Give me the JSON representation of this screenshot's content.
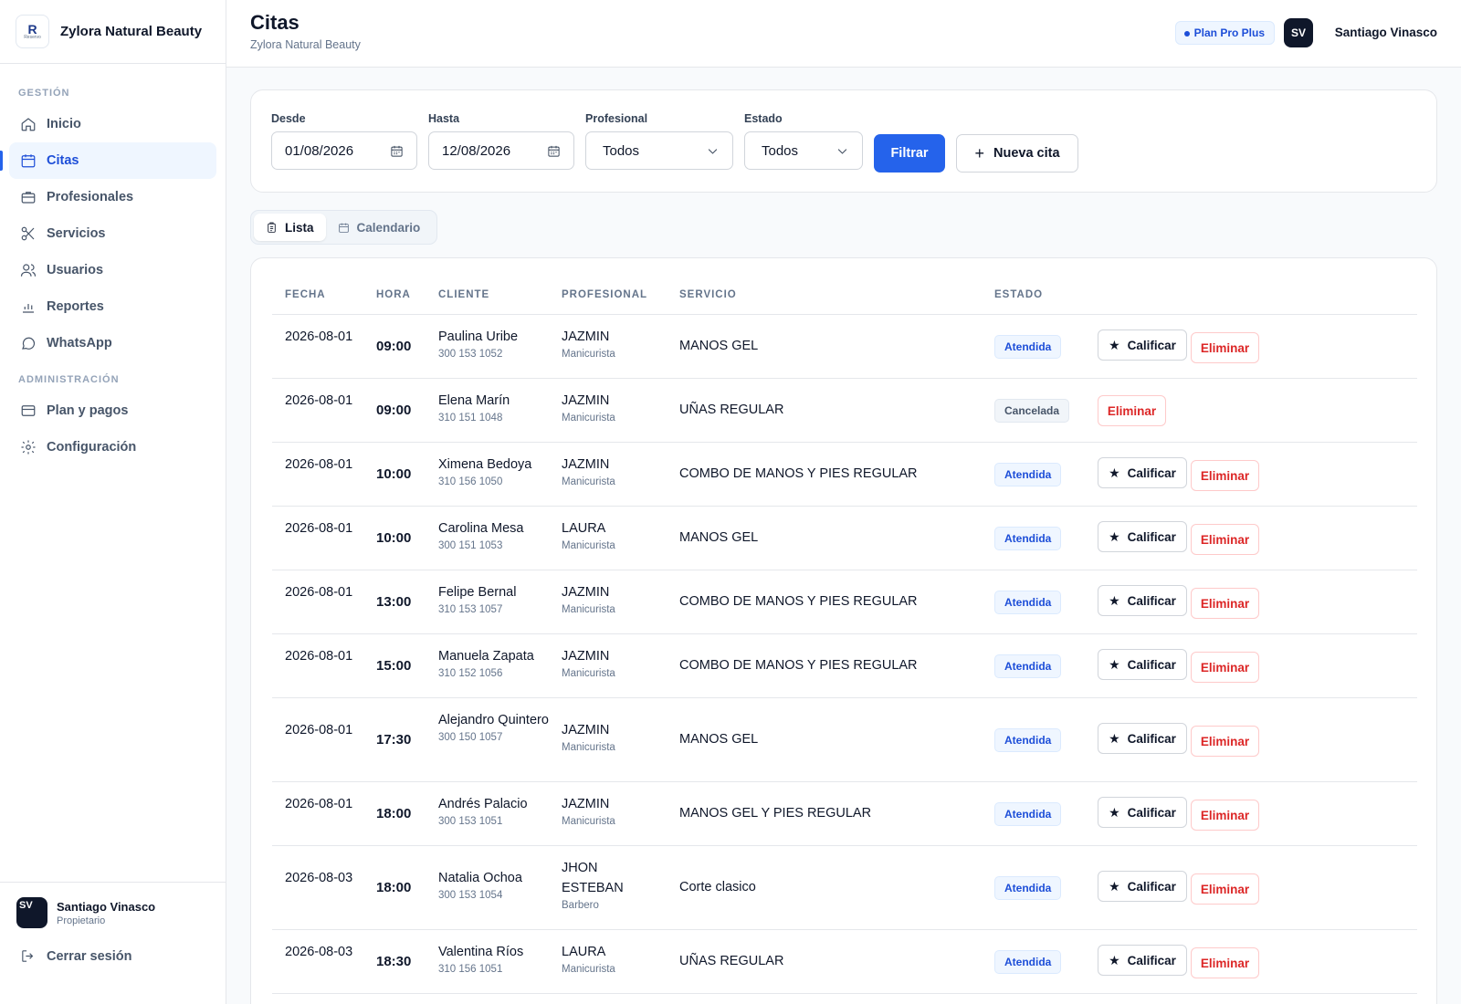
{
  "brand": {
    "name": "Zylora Natural Beauty",
    "logo_letter": "R",
    "logo_sub": "Reservo"
  },
  "sidebar": {
    "section_gestion": "GESTIÓN",
    "section_admin": "ADMINISTRACIÓN",
    "items": [
      {
        "label": "Inicio",
        "icon": "home-icon"
      },
      {
        "label": "Citas",
        "icon": "calendar-icon",
        "active": true
      },
      {
        "label": "Profesionales",
        "icon": "briefcase-icon"
      },
      {
        "label": "Servicios",
        "icon": "scissors-icon"
      },
      {
        "label": "Usuarios",
        "icon": "users-icon"
      },
      {
        "label": "Reportes",
        "icon": "bar-chart-icon"
      },
      {
        "label": "WhatsApp",
        "icon": "chat-bubble-icon"
      }
    ],
    "admin_items": [
      {
        "label": "Plan y pagos",
        "icon": "credit-card-icon"
      },
      {
        "label": "Configuración",
        "icon": "gear-icon"
      }
    ],
    "user": {
      "initials": "SV",
      "name": "Santiago Vinasco",
      "role": "Propietario"
    },
    "logout": "Cerrar sesión"
  },
  "header": {
    "title": "Citas",
    "subtitle": "Zylora Natural Beauty",
    "plan": "Plan Pro Plus",
    "user_initials": "SV",
    "user_name": "Santiago Vinasco"
  },
  "filters": {
    "desde_label": "Desde",
    "desde_value": "01/08/2026",
    "hasta_label": "Hasta",
    "hasta_value": "12/08/2026",
    "profesional_label": "Profesional",
    "profesional_value": "Todos",
    "estado_label": "Estado",
    "estado_value": "Todos",
    "filter_button": "Filtrar",
    "new_button": "Nueva cita"
  },
  "view_toggle": {
    "list": "Lista",
    "calendar": "Calendario"
  },
  "table": {
    "headers": {
      "fecha": "FECHA",
      "hora": "HORA",
      "cliente": "CLIENTE",
      "profesional": "PROFESIONAL",
      "servicio": "SERVICIO",
      "estado": "ESTADO"
    },
    "rate_label": "Calificar",
    "delete_label": "Eliminar",
    "rows": [
      {
        "fecha": "2026-08-01",
        "hora": "09:00",
        "cliente": "Paulina Uribe",
        "telefono": "300 153 1052",
        "profesional": "JAZMIN",
        "rol": "Manicurista",
        "servicio": "MANOS GEL",
        "estado": "Atendida"
      },
      {
        "fecha": "2026-08-01",
        "hora": "09:00",
        "cliente": "Elena Marín",
        "telefono": "310 151 1048",
        "profesional": "JAZMIN",
        "rol": "Manicurista",
        "servicio": "UÑAS REGULAR",
        "estado": "Cancelada"
      },
      {
        "fecha": "2026-08-01",
        "hora": "10:00",
        "cliente": "Ximena Bedoya",
        "telefono": "310 156 1050",
        "profesional": "JAZMIN",
        "rol": "Manicurista",
        "servicio": "COMBO DE MANOS Y PIES REGULAR",
        "estado": "Atendida"
      },
      {
        "fecha": "2026-08-01",
        "hora": "10:00",
        "cliente": "Carolina Mesa",
        "telefono": "300 151 1053",
        "profesional": "LAURA",
        "rol": "Manicurista",
        "servicio": "MANOS GEL",
        "estado": "Atendida"
      },
      {
        "fecha": "2026-08-01",
        "hora": "13:00",
        "cliente": "Felipe Bernal",
        "telefono": "310 153 1057",
        "profesional": "JAZMIN",
        "rol": "Manicurista",
        "servicio": "COMBO DE MANOS Y PIES REGULAR",
        "estado": "Atendida"
      },
      {
        "fecha": "2026-08-01",
        "hora": "15:00",
        "cliente": "Manuela Zapata",
        "telefono": "310 152 1056",
        "profesional": "JAZMIN",
        "rol": "Manicurista",
        "servicio": "COMBO DE MANOS Y PIES REGULAR",
        "estado": "Atendida"
      },
      {
        "fecha": "2026-08-01",
        "hora": "17:30",
        "cliente": "Alejandro Quintero",
        "telefono": "300 150 1057",
        "profesional": "JAZMIN",
        "rol": "Manicurista",
        "servicio": "MANOS GEL",
        "estado": "Atendida"
      },
      {
        "fecha": "2026-08-01",
        "hora": "18:00",
        "cliente": "Andrés Palacio",
        "telefono": "300 153 1051",
        "profesional": "JAZMIN",
        "rol": "Manicurista",
        "servicio": "MANOS GEL Y PIES REGULAR",
        "estado": "Atendida"
      },
      {
        "fecha": "2026-08-03",
        "hora": "18:00",
        "cliente": "Natalia Ochoa",
        "telefono": "300 153 1054",
        "profesional": "JHON ESTEBAN",
        "rol": "Barbero",
        "servicio": "Corte clasico",
        "estado": "Atendida"
      },
      {
        "fecha": "2026-08-03",
        "hora": "18:30",
        "cliente": "Valentina Ríos",
        "telefono": "310 156 1051",
        "profesional": "LAURA",
        "rol": "Manicurista",
        "servicio": "UÑAS REGULAR",
        "estado": "Atendida"
      }
    ]
  }
}
